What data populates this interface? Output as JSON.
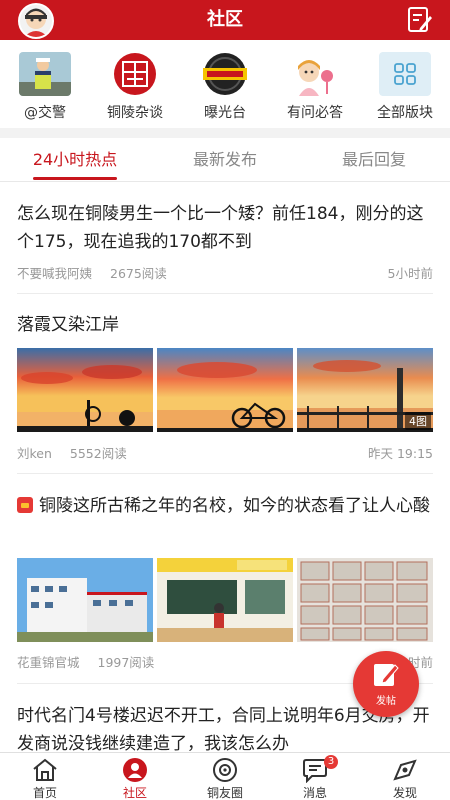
{
  "header": {
    "title": "社区"
  },
  "boards": [
    {
      "label": "@交警",
      "icon": "traffic-police-icon"
    },
    {
      "label": "铜陵杂谈",
      "icon": "tongling-seal-icon"
    },
    {
      "label": "曝光台",
      "icon": "exposure-icon"
    },
    {
      "label": "有问必答",
      "icon": "qa-icon"
    },
    {
      "label": "全部版块",
      "icon": "grid-icon"
    }
  ],
  "tabs": [
    {
      "label": "24小时热点",
      "active": true
    },
    {
      "label": "最新发布",
      "active": false
    },
    {
      "label": "最后回复",
      "active": false
    }
  ],
  "posts": [
    {
      "title": "怎么现在铜陵男生一个比一个矮？前任184，刚分的这个175，现在追我的170都不到",
      "author": "不要喊我阿姨",
      "reads": "2675阅读",
      "time": "5小时前"
    },
    {
      "title": "落霞又染江岸",
      "author": "刘ken",
      "reads": "5552阅读",
      "time": "昨天 19:15",
      "image_count": "4图"
    },
    {
      "title": "铜陵这所古稀之年的名校，如今的状态看了让人心酸",
      "author": "花重锦官城",
      "reads": "1997阅读",
      "time": "1小时前"
    },
    {
      "title": "时代名门4号楼迟迟不开工，合同上说明年6月交房，开发商说没钱继续建造了，我该怎么办"
    }
  ],
  "fab": {
    "label": "发帖"
  },
  "bottom_nav": [
    {
      "label": "首页",
      "icon": "home-icon",
      "active": false
    },
    {
      "label": "社区",
      "icon": "community-icon",
      "active": true
    },
    {
      "label": "铜友圈",
      "icon": "friends-circle-icon",
      "active": false
    },
    {
      "label": "消息",
      "icon": "message-icon",
      "active": false,
      "badge": "3"
    },
    {
      "label": "发现",
      "icon": "discover-icon",
      "active": false
    }
  ],
  "colors": {
    "brand": "#c8161d",
    "fab": "#e53935"
  }
}
